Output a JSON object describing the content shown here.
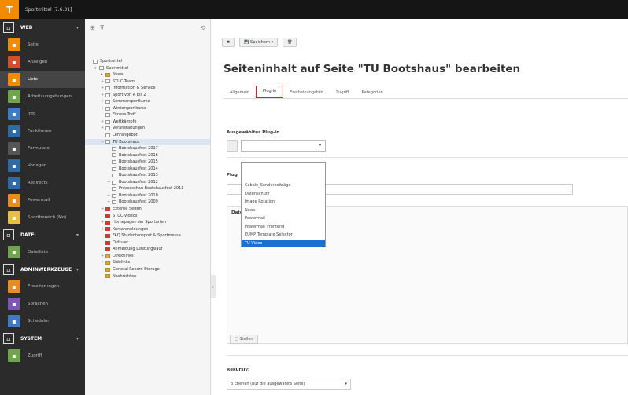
{
  "app": {
    "site_name": "Sportmittel [7.6.31]",
    "logo_glyph": "T",
    "accent": "#f28b00"
  },
  "module_menu": {
    "groups": [
      {
        "label": "WEB",
        "icon": "page-icon",
        "items": [
          {
            "label": "Seite",
            "color": "#f28b00"
          },
          {
            "label": "Anzeigen",
            "color": "#d64e2c"
          },
          {
            "label": "Liste",
            "color": "#f28b00",
            "active": true
          },
          {
            "label": "Arbeitsumgebungen",
            "color": "#6ea64b"
          },
          {
            "label": "Info",
            "color": "#3f7ac7"
          },
          {
            "label": "Funktionen",
            "color": "#2d6aa6"
          },
          {
            "label": "Formulare",
            "color": "#555555"
          },
          {
            "label": "Vorlagen",
            "color": "#2d6aa6"
          },
          {
            "label": "Redirects",
            "color": "#2d6aa6"
          },
          {
            "label": "Powermail",
            "color": "#e98b1e"
          },
          {
            "label": "Sportbereich (Mo)",
            "color": "#e8c041"
          }
        ]
      },
      {
        "label": "DATEI",
        "icon": "image-icon",
        "items": [
          {
            "label": "Dateiliste",
            "color": "#6ea64b"
          }
        ]
      },
      {
        "label": "ADMINWERKZEUGE",
        "icon": "tools-icon",
        "items": [
          {
            "label": "Erweiterungen",
            "color": "#e98b1e"
          },
          {
            "label": "Sprachen",
            "color": "#7a58b4"
          },
          {
            "label": "Scheduler",
            "color": "#3f7ac7"
          }
        ]
      },
      {
        "label": "SYSTEM",
        "icon": "wrench-icon",
        "items": [
          {
            "label": "Zugriff",
            "color": "#6ea64b"
          }
        ]
      }
    ]
  },
  "page_tree": {
    "nodes": [
      {
        "label": "Sportmittel",
        "indent": 0,
        "type": "root"
      },
      {
        "label": "Sportmittel",
        "indent": 1,
        "type": "globe",
        "exp": "▾"
      },
      {
        "label": "News",
        "indent": 2,
        "type": "folder",
        "exp": "▸"
      },
      {
        "label": "STUC-Team",
        "indent": 2,
        "type": "page",
        "exp": "+"
      },
      {
        "label": "Information & Service",
        "indent": 2,
        "type": "page",
        "exp": "+"
      },
      {
        "label": "Sport von A bis Z",
        "indent": 2,
        "type": "page",
        "exp": "+"
      },
      {
        "label": "Sommersportkurse",
        "indent": 2,
        "type": "page",
        "exp": "+"
      },
      {
        "label": "Wintersportkurse",
        "indent": 2,
        "type": "page",
        "exp": "+"
      },
      {
        "label": "Fitness-Treff",
        "indent": 2,
        "type": "page",
        "exp": ""
      },
      {
        "label": "Wettkämpfe",
        "indent": 2,
        "type": "page",
        "exp": "+"
      },
      {
        "label": "Veranstaltungen",
        "indent": 2,
        "type": "page",
        "exp": "+"
      },
      {
        "label": "Lehrangebot",
        "indent": 2,
        "type": "page",
        "exp": ""
      },
      {
        "label": "TU Bootshaus",
        "indent": 2,
        "type": "page",
        "exp": "−",
        "selected": true
      },
      {
        "label": "Bootshausfest 2017",
        "indent": 3,
        "type": "page",
        "exp": ""
      },
      {
        "label": "Bootshausfest 2016",
        "indent": 3,
        "type": "page",
        "exp": ""
      },
      {
        "label": "Bootshausfest 2015",
        "indent": 3,
        "type": "page",
        "exp": ""
      },
      {
        "label": "Bootshausfest 2014",
        "indent": 3,
        "type": "page",
        "exp": ""
      },
      {
        "label": "Bootshausfest 2013",
        "indent": 3,
        "type": "page",
        "exp": ""
      },
      {
        "label": "Bootshausfest 2012",
        "indent": 3,
        "type": "page",
        "exp": "+"
      },
      {
        "label": "Presseschau Bootshausfest 2011",
        "indent": 3,
        "type": "page",
        "exp": ""
      },
      {
        "label": "Bootshausfest 2010",
        "indent": 3,
        "type": "page",
        "exp": "+"
      },
      {
        "label": "Bootshausfest 2009",
        "indent": 3,
        "type": "page",
        "exp": "+"
      },
      {
        "label": "Externe Seiten",
        "indent": 2,
        "type": "red",
        "exp": "+"
      },
      {
        "label": "STUC-Videos",
        "indent": 2,
        "type": "red",
        "exp": ""
      },
      {
        "label": "Homepages der Sportarten",
        "indent": 2,
        "type": "red",
        "exp": "+"
      },
      {
        "label": "Kursanmeldungen",
        "indent": 2,
        "type": "red",
        "exp": "+"
      },
      {
        "label": "FAQ Studentensport & Sportmesse",
        "indent": 2,
        "type": "red",
        "exp": ""
      },
      {
        "label": "Oldtuler",
        "indent": 2,
        "type": "red",
        "exp": ""
      },
      {
        "label": "Anmeldung Leistungslauf",
        "indent": 2,
        "type": "red",
        "exp": ""
      },
      {
        "label": "Direktlinks",
        "indent": 2,
        "type": "folder",
        "exp": "+"
      },
      {
        "label": "Sidelinks",
        "indent": 2,
        "type": "folder",
        "exp": "+"
      },
      {
        "label": "General Record Storage",
        "indent": 2,
        "type": "folder",
        "exp": ""
      },
      {
        "label": "Nachrichten",
        "indent": 2,
        "type": "folder",
        "exp": ""
      }
    ]
  },
  "toolbar": {
    "close_label": "✖",
    "save_label": "Speichern",
    "delete_label": "🗑"
  },
  "page_title": "Seiteninhalt auf Seite \"TU Bootshaus\" bearbeiten",
  "tabs": [
    "Allgemein",
    "Plug-In",
    "Erscheinungsbild",
    "Zugriff",
    "Kategorien"
  ],
  "active_tab": 1,
  "plugin_field": {
    "label": "Ausgewähltes Plug-in",
    "value": ""
  },
  "plugin_options": [
    "Cabalo_Sonderbeiträge",
    "Datenschutz",
    "Image Rotation",
    "News",
    "Powermail",
    "Powermail_Frontend",
    "EUMP Template Selector",
    "TU Video"
  ],
  "highlighted_option": 7,
  "second_label": "Plug",
  "third_label": "Datei",
  "small_button_label": "Stellen",
  "recursive": {
    "label": "Rekursiv:",
    "value": "3 Ebenen (nur die ausgewählte Seite)"
  }
}
